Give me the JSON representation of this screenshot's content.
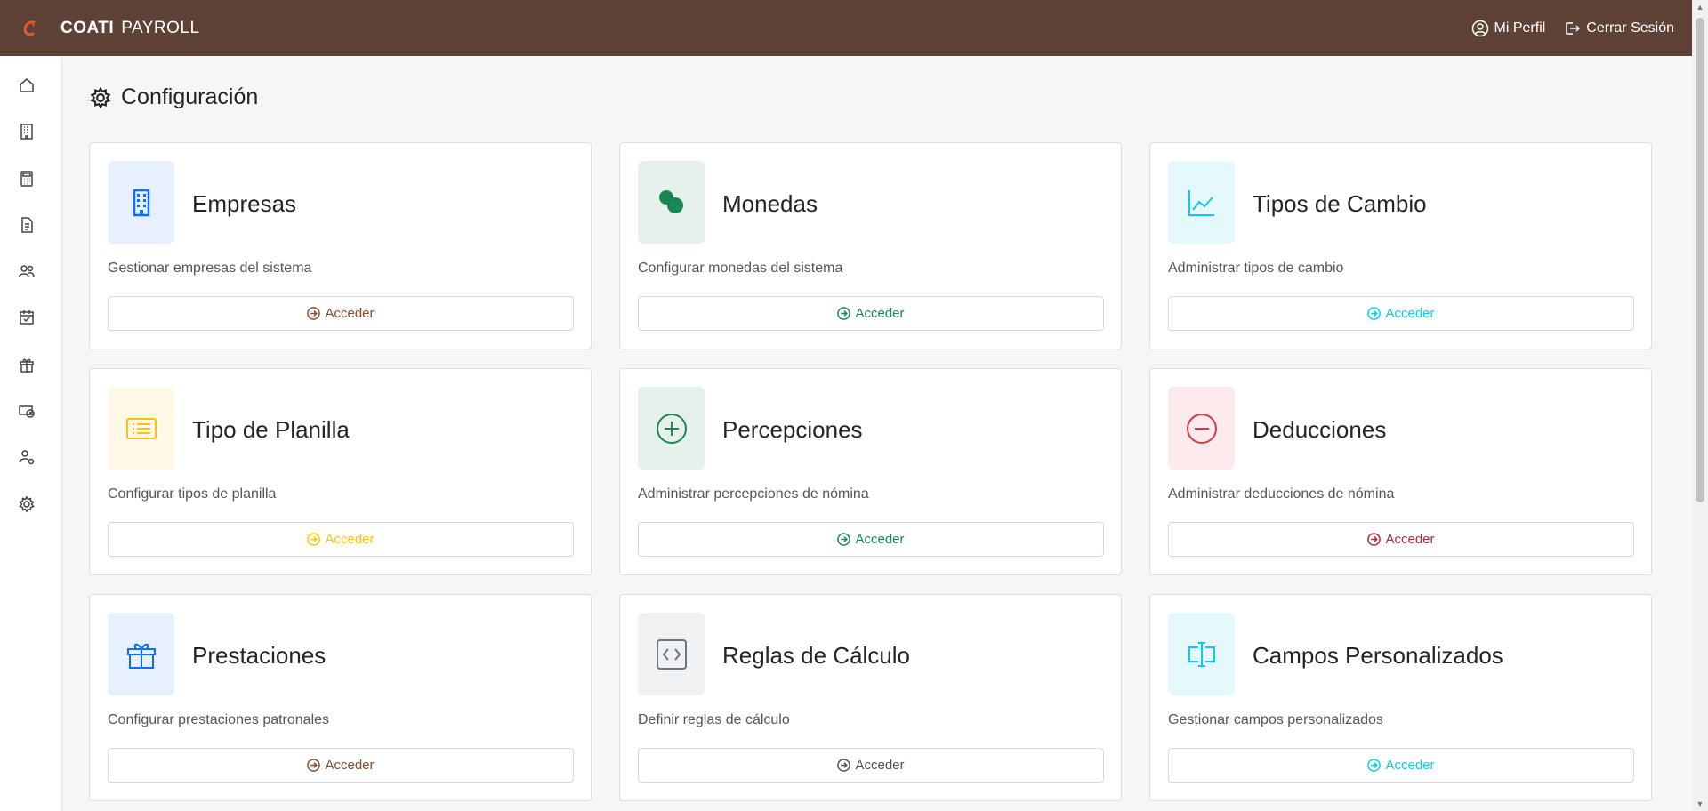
{
  "brand": {
    "name_bold": "COATI",
    "name_light": "PAYROLL"
  },
  "header": {
    "profile_label": "Mi Perfil",
    "logout_label": "Cerrar Sesión"
  },
  "sidebar": {
    "items": [
      {
        "icon": "home-icon"
      },
      {
        "icon": "building-icon"
      },
      {
        "icon": "calculator-icon"
      },
      {
        "icon": "document-icon"
      },
      {
        "icon": "users-icon"
      },
      {
        "icon": "calendar-check-icon"
      },
      {
        "icon": "gift-icon"
      },
      {
        "icon": "cash-icon"
      },
      {
        "icon": "user-gear-icon"
      },
      {
        "icon": "gear-icon"
      }
    ]
  },
  "page": {
    "title": "Configuración"
  },
  "cards": [
    {
      "title": "Empresas",
      "description": "Gestionar empresas del sistema",
      "button": "Acceder",
      "icon": "building-icon",
      "color": "#0d6efd",
      "bg": "#e7f0fe",
      "btn_color": "#8b4a2b"
    },
    {
      "title": "Monedas",
      "description": "Configurar monedas del sistema",
      "button": "Acceder",
      "icon": "coins-icon",
      "color": "#198754",
      "bg": "#e6f1ec",
      "btn_color": "#198754"
    },
    {
      "title": "Tipos de Cambio",
      "description": "Administrar tipos de cambio",
      "button": "Acceder",
      "icon": "chart-line-icon",
      "color": "#0dcaf0",
      "bg": "#e5f9fd",
      "btn_color": "#0dcaf0"
    },
    {
      "title": "Tipo de Planilla",
      "description": "Configurar tipos de planilla",
      "button": "Acceder",
      "icon": "list-icon",
      "color": "#ffc107",
      "bg": "#fff8e6",
      "btn_color": "#ffc107"
    },
    {
      "title": "Percepciones",
      "description": "Administrar percepciones de nómina",
      "button": "Acceder",
      "icon": "plus-circle-icon",
      "color": "#198754",
      "bg": "#e6f1ec",
      "btn_color": "#198754"
    },
    {
      "title": "Deducciones",
      "description": "Administrar deducciones de nómina",
      "button": "Acceder",
      "icon": "minus-circle-icon",
      "color": "#dc3545",
      "bg": "#fceaec",
      "btn_color": "#b02a37"
    },
    {
      "title": "Prestaciones",
      "description": "Configurar prestaciones patronales",
      "button": "Acceder",
      "icon": "gift-icon",
      "color": "#0d6efd",
      "bg": "#e7f0fe",
      "btn_color": "#8b4a2b"
    },
    {
      "title": "Reglas de Cálculo",
      "description": "Definir reglas de cálculo",
      "button": "Acceder",
      "icon": "code-icon",
      "color": "#6c757d",
      "bg": "#f0f1f2",
      "btn_color": "#495057"
    },
    {
      "title": "Campos Personalizados",
      "description": "Gestionar campos personalizados",
      "button": "Acceder",
      "icon": "input-cursor-icon",
      "color": "#0dcaf0",
      "bg": "#e5f9fd",
      "btn_color": "#0dcaf0"
    }
  ]
}
